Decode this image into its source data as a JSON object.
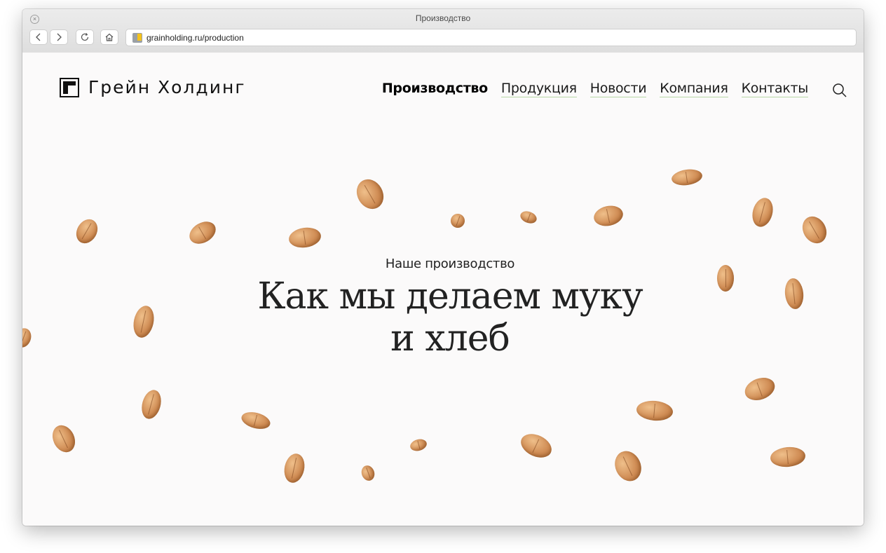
{
  "browser": {
    "window_title": "Производство",
    "url": "grainholding.ru/production",
    "close_symbol": "×"
  },
  "site": {
    "logo_text": "Грейн Холдинг",
    "nav": [
      {
        "label": "Производство",
        "active": true
      },
      {
        "label": "Продукция",
        "active": false
      },
      {
        "label": "Новости",
        "active": false
      },
      {
        "label": "Компания",
        "active": false
      },
      {
        "label": "Контакты",
        "active": false
      }
    ],
    "search_icon": "search-icon"
  },
  "hero": {
    "subtitle": "Наше производство",
    "title_line1": "Как мы делаем муку",
    "title_line2": "и хлеб"
  },
  "colors": {
    "grain": "#d08d55",
    "nav_underline": "#b8d8a6",
    "text": "#222222",
    "background": "#fbfafa"
  }
}
